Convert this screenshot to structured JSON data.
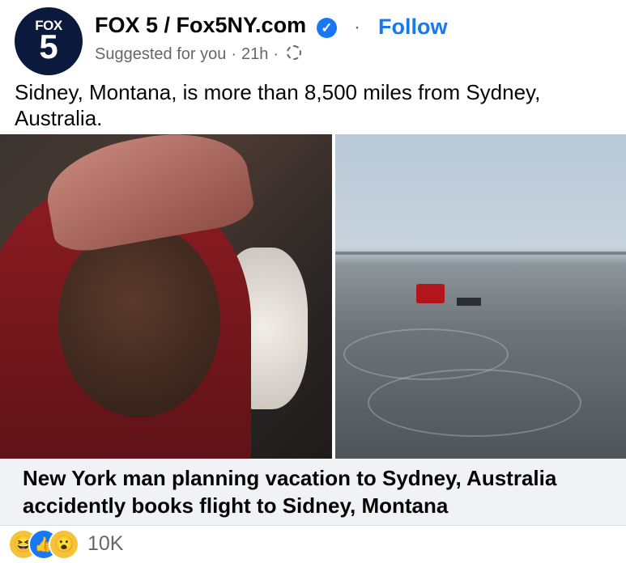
{
  "post": {
    "avatar_top": "FOX",
    "avatar_num": "5",
    "page_name": "FOX 5 / Fox5NY.com",
    "follow_label": "Follow",
    "meta_suggested": "Suggested for you",
    "meta_time": "21h",
    "caption": "Sidney, Montana, is more than 8,500 miles from Sydney, Australia.",
    "headline": "New York man planning vacation to Sydney, Australia accidently books flight to Sidney, Montana",
    "reaction_count": "10K",
    "colors": {
      "accent": "#1877f2",
      "text": "#050505",
      "muted": "#65676b",
      "headline_bg": "#f0f2f5",
      "avatar_bg": "#0b1a3c"
    },
    "icons": {
      "verified": "verified-check-icon",
      "audience": "gear-icon",
      "reactions": [
        "haha-icon",
        "like-icon",
        "wow-icon"
      ]
    }
  }
}
